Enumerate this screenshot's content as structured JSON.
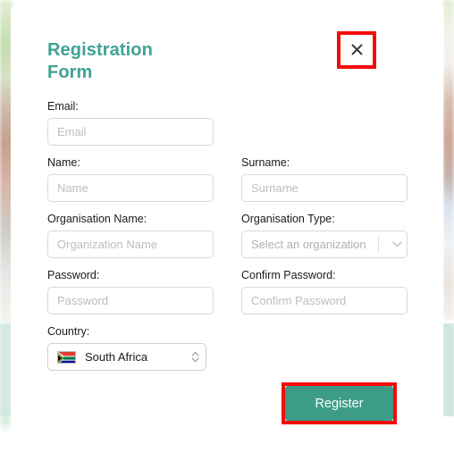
{
  "modal": {
    "title": "Registration\nForm",
    "title_line1": "Registration",
    "title_line2": "Form",
    "close_label": "×",
    "accent_color": "#3fa393",
    "annotation_color": "#f60b0b"
  },
  "form": {
    "email": {
      "label": "Email:",
      "placeholder": "Email",
      "value": ""
    },
    "name": {
      "label": "Name:",
      "placeholder": "Name",
      "value": ""
    },
    "surname": {
      "label": "Surname:",
      "placeholder": "Surname",
      "value": ""
    },
    "organisation_name": {
      "label": "Organisation Name:",
      "placeholder": "Organization Name",
      "value": ""
    },
    "organisation_type": {
      "label": "Organisation Type:",
      "selected": "Select an organization"
    },
    "password": {
      "label": "Password:",
      "placeholder": "Password",
      "value": ""
    },
    "confirm_password": {
      "label": "Confirm Password:",
      "placeholder": "Confirm Password",
      "value": ""
    },
    "country": {
      "label": "Country:",
      "selected": "South Africa",
      "flag": "south-africa-flag"
    }
  },
  "actions": {
    "register_label": "Register",
    "register_color": "#3c9c87"
  }
}
